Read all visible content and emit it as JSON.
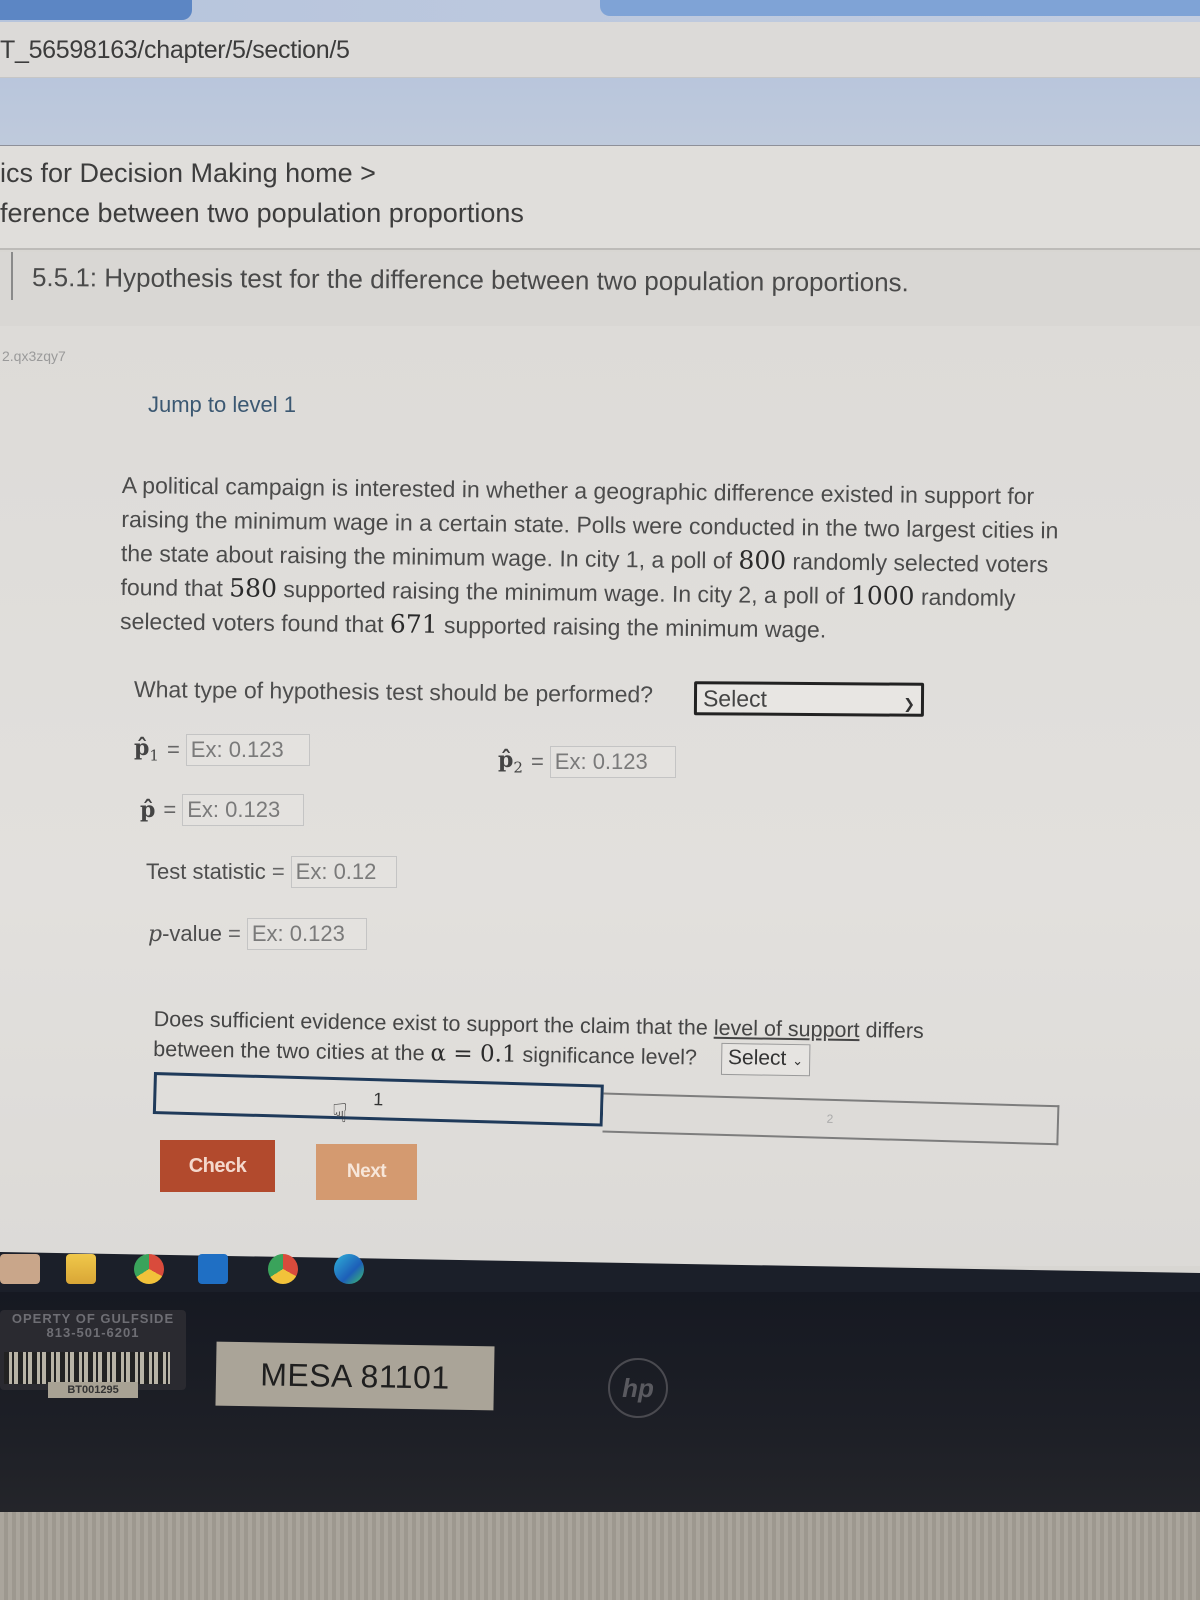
{
  "browser": {
    "url": "T_56598163/chapter/5/section/5"
  },
  "breadcrumb": {
    "line1": "ics for Decision Making home >",
    "line2": "ference between two population proportions"
  },
  "section": {
    "title": "5.5.1: Hypothesis test for the difference between two population proportions."
  },
  "activity": {
    "id": "2.qx3zqy7",
    "jump_link": "Jump to level 1",
    "prompt_parts": {
      "p1": "A political campaign is interested in whether a geographic difference existed in support for raising the minimum wage in a certain state. Polls were conducted in the two largest cities in the state about raising the minimum wage. In city 1, a poll of ",
      "n1": "800",
      "p2": " randomly selected voters found that ",
      "x1": "580",
      "p3": " supported raising the minimum wage. In city 2, a poll of ",
      "n2": "1000",
      "p4": " randomly selected voters found that ",
      "x2": "671",
      "p5": " supported raising the minimum wage."
    },
    "question1": {
      "label": "What type of hypothesis test should be performed?",
      "select_value": "Select",
      "chevron_icon": "chevron-down-icon"
    },
    "fields": {
      "p1_hat": {
        "symbol": "p̂",
        "subscript": "1",
        "placeholder": "Ex: 0.123"
      },
      "p2_hat": {
        "symbol": "p̂",
        "subscript": "2",
        "placeholder": "Ex: 0.123"
      },
      "p_hat": {
        "symbol": "p̂",
        "placeholder": "Ex: 0.123"
      },
      "test_statistic": {
        "label": "Test statistic",
        "placeholder": "Ex: 0.12"
      },
      "p_value": {
        "label_italic": "p",
        "label_rest": "-value",
        "placeholder": "Ex: 0.123"
      },
      "equals": "="
    },
    "question2": {
      "part1": "Does sufficient evidence exist to support the claim that the ",
      "underlined": "level of support",
      "part2": " differs between the two cities at the ",
      "alpha": "α",
      "alpha_eq": " = ",
      "alpha_value": "0.1",
      "part3": " significance level?",
      "select_value": "Select"
    },
    "levels": [
      {
        "label": "1",
        "active": true
      },
      {
        "label": "2",
        "active": false
      }
    ],
    "buttons": {
      "check": "Check",
      "next": "Next"
    }
  },
  "taskbar": {
    "icons": [
      "desktop-app-icon",
      "file-explorer-icon",
      "chrome-icon",
      "outlook-icon",
      "chrome-profile-icon",
      "edge-icon"
    ]
  },
  "hardware": {
    "property_sticker": "OPERTY OF GULFSIDE",
    "property_phone": "813-501-6201",
    "barcode_label": "BT001295",
    "asset_tag": "MESA 81101",
    "logo": "hp"
  },
  "colors": {
    "check_button": "#b24a2d",
    "next_button": "#d49a70",
    "active_level_border": "#1f3a5a",
    "link": "#3b5872"
  }
}
